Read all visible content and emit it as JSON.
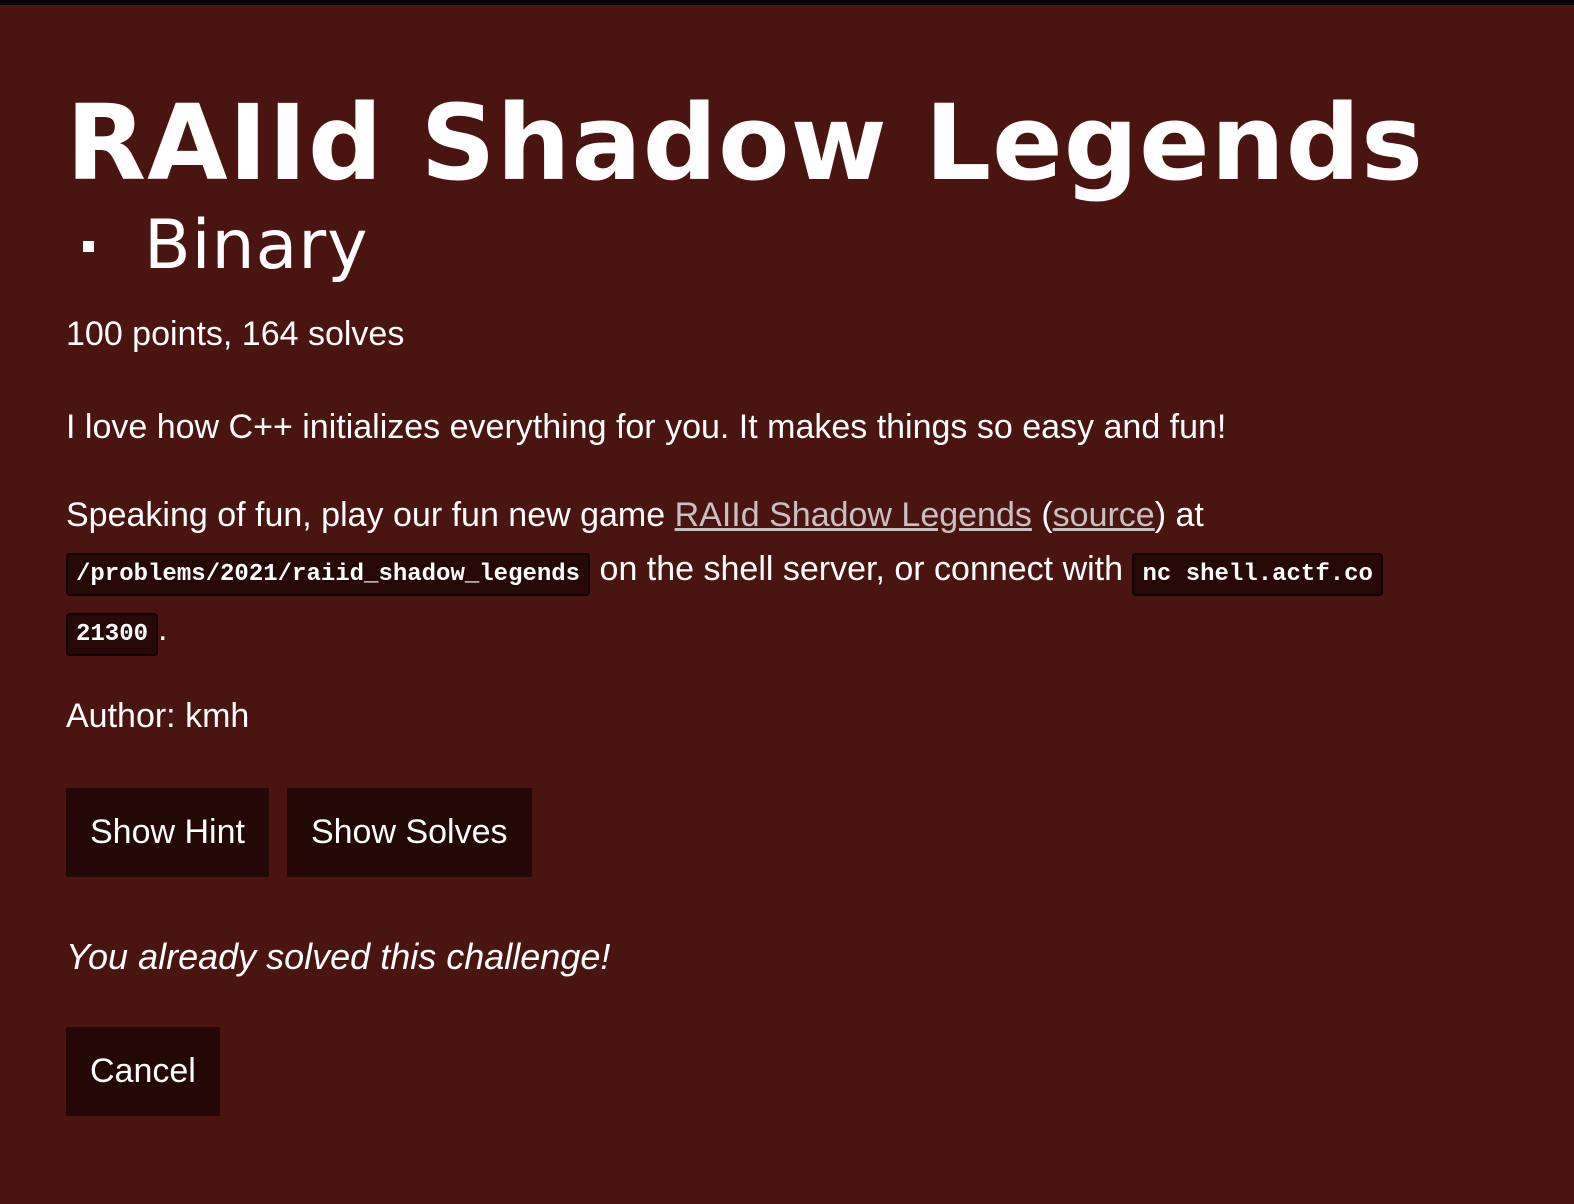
{
  "challenge": {
    "title": "RAIId Shadow Legends",
    "category": "Binary",
    "meta": "100 points, 164 solves",
    "description_line1": "I love how C++ initializes everything for you. It makes things so easy and fun!",
    "description_line2": {
      "prefix": "Speaking of fun, play our fun new game ",
      "game_link": "RAIId Shadow Legends",
      "paren_open": " (",
      "source_link": "source",
      "paren_close": ") at",
      "path_code": "/problems/2021/raiid_shadow_legends",
      "middle": " on the shell server, or connect with ",
      "nc_code": "nc shell.actf.co",
      "port_code": "21300",
      "suffix": "."
    },
    "author": "Author: kmh",
    "buttons": {
      "show_hint": "Show Hint",
      "show_solves": "Show Solves",
      "cancel": "Cancel"
    },
    "solved_message": "You already solved this challenge!"
  },
  "colors": {
    "background": "#4a1410",
    "button_bg": "#240806",
    "link": "#c9c1c0",
    "code_bg": "#260807"
  }
}
